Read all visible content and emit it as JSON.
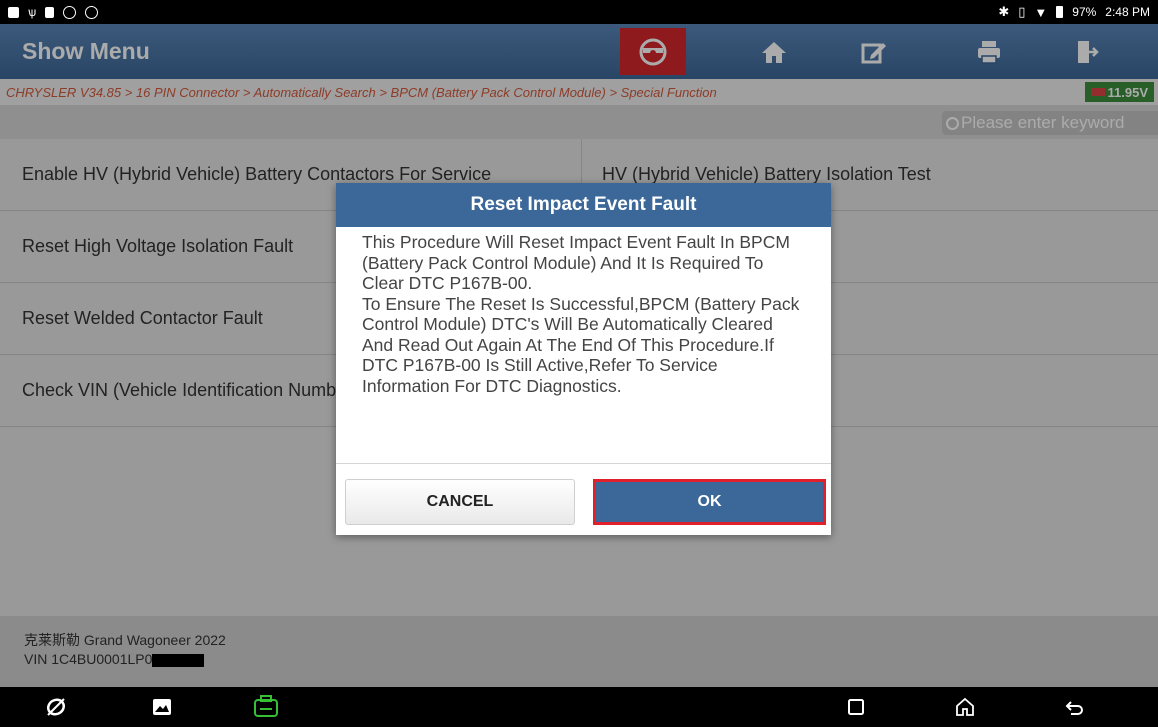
{
  "status_bar": {
    "battery": "97%",
    "time": "2:48 PM"
  },
  "header": {
    "title": "Show Menu"
  },
  "breadcrumb": {
    "text": "CHRYSLER V34.85 > 16 PIN Connector > Automatically Search > BPCM (Battery Pack Control Module) > Special Function",
    "voltage": "11.95V"
  },
  "search": {
    "placeholder": "Please enter keyword"
  },
  "menu": {
    "items": [
      {
        "label": "Enable HV (Hybrid Vehicle) Battery Contactors For Service"
      },
      {
        "label": "HV (Hybrid Vehicle) Battery Isolation Test"
      },
      {
        "label": "Reset High Voltage Isolation Fault"
      },
      {
        "label": "Reset Welded Contactor Fault"
      },
      {
        "label": "Check VIN (Vehicle Identification Number)"
      }
    ]
  },
  "footer": {
    "vehicle": "克莱斯勒 Grand Wagoneer 2022",
    "vin": "VIN 1C4BU0001LP0"
  },
  "dialog": {
    "title": "Reset Impact Event Fault",
    "message": "This Procedure Will Reset Impact Event Fault In BPCM (Battery Pack Control Module) And It Is Required To Clear DTC P167B-00.\nTo Ensure The Reset Is Successful,BPCM (Battery Pack Control Module) DTC's Will Be Automatically Cleared And Read Out Again At The End Of This Procedure.If DTC P167B-00 Is Still Active,Refer To Service Information For DTC Diagnostics.",
    "cancel_label": "CANCEL",
    "ok_label": "OK"
  },
  "colors": {
    "header": "#3d6898",
    "accent_red": "#d4282d",
    "voltage_green": "#3c8c3c",
    "breadcrumb_text": "#d35a3c"
  }
}
